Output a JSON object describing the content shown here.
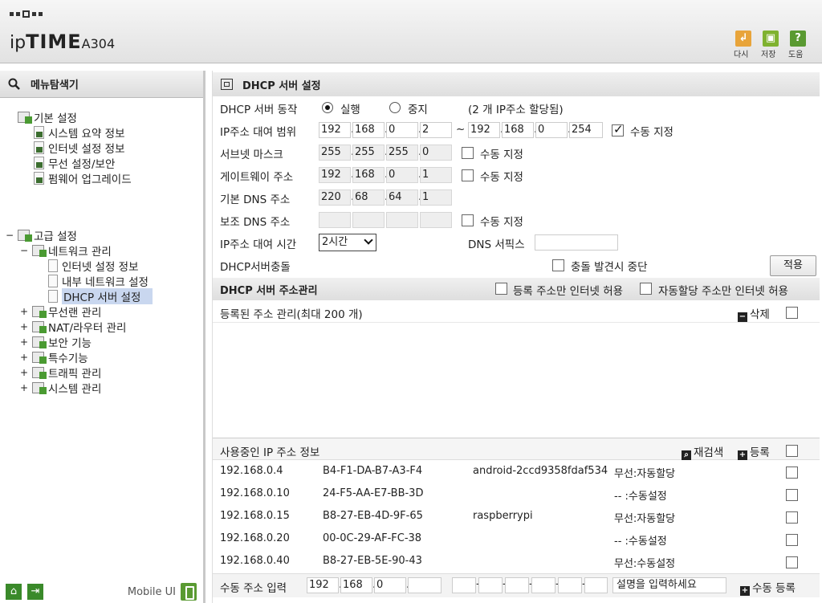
{
  "header": {
    "model_prefix": "ip",
    "model_brand": "TIME",
    "model_name": "A304",
    "buttons": [
      {
        "label": "다시",
        "icon": "undo-icon",
        "color": "#e8a43a"
      },
      {
        "label": "저장",
        "icon": "save-icon",
        "color": "#7fb230"
      },
      {
        "label": "도움",
        "icon": "help-icon",
        "color": "#5a9a32"
      }
    ]
  },
  "sidebar": {
    "title": "메뉴탐색기",
    "groups": [
      {
        "label": "기본 설정",
        "toggle": ""
      },
      {
        "label": "시스템 요약 정보"
      },
      {
        "label": "인터넷 설정 정보"
      },
      {
        "label": "무선 설정/보안"
      },
      {
        "label": "펌웨어 업그레이드"
      },
      {
        "label": "고급 설정",
        "toggle": "−"
      },
      {
        "label": "네트워크 관리",
        "toggle": "−"
      },
      {
        "label": "인터넷 설정 정보"
      },
      {
        "label": "내부 네트워크 설정"
      },
      {
        "label": "DHCP 서버 설정"
      },
      {
        "label": "무선랜 관리",
        "toggle": "+"
      },
      {
        "label": "NAT/라우터 관리",
        "toggle": "+"
      },
      {
        "label": "보안 기능",
        "toggle": "+"
      },
      {
        "label": "특수기능",
        "toggle": "+"
      },
      {
        "label": "트래픽 관리",
        "toggle": "+"
      },
      {
        "label": "시스템 관리",
        "toggle": "+"
      }
    ],
    "mobile_label": "Mobile UI"
  },
  "dhcp": {
    "title": "DHCP 서버 설정",
    "server_label": "DHCP 서버 동작",
    "run_label": "실행",
    "stop_label": "중지",
    "ip_note": "(2 개 IP주소 할당됨)",
    "range_label": "IP주소 대여 범위",
    "range_start": [
      "192",
      "168",
      "0",
      "2"
    ],
    "range_sep": "~",
    "range_end": [
      "192",
      "168",
      "0",
      "254"
    ],
    "manual_label": "수동 지정",
    "subnet_label": "서브넷 마스크",
    "subnet": [
      "255",
      "255",
      "255",
      "0"
    ],
    "gateway_label": "게이트웨이 주소",
    "gateway": [
      "192",
      "168",
      "0",
      "1"
    ],
    "dns1_label": "기본 DNS 주소",
    "dns1": [
      "220",
      "68",
      "64",
      "1"
    ],
    "dns2_label": "보조 DNS 주소",
    "lease_label": "IP주소 대여 시간",
    "lease_value": "2시간",
    "dns_suffix_label": "DNS 서픽스",
    "conflict_label": "DHCP서버충돌",
    "conflict_stop_label": "충돌 발견시 중단",
    "apply_label": "적용"
  },
  "addr_mgmt": {
    "title": "DHCP 서버 주소관리",
    "registered_only_label": "등록 주소만 인터넷 허용",
    "auto_only_label": "자동할당 주소만 인터넷 허용",
    "registered_list_label": "등록된 주소 관리(최대 200 개)",
    "delete_label": "삭제"
  },
  "in_use": {
    "title": "사용중인 IP 주소 정보",
    "rescan_label": "재검색",
    "register_label": "등록",
    "rows": [
      {
        "ip": "192.168.0.4",
        "mac": "B4-F1-DA-B7-A3-F4",
        "host": "android-2ccd9358fdaf534",
        "type": "무선:자동할당"
      },
      {
        "ip": "192.168.0.10",
        "mac": "24-F5-AA-E7-BB-3D",
        "host": "",
        "type": "-- :수동설정"
      },
      {
        "ip": "192.168.0.15",
        "mac": "B8-27-EB-4D-9F-65",
        "host": "raspberrypi",
        "type": "무선:자동할당"
      },
      {
        "ip": "192.168.0.20",
        "mac": "00-0C-29-AF-FC-38",
        "host": "",
        "type": "-- :수동설정"
      },
      {
        "ip": "192.168.0.40",
        "mac": "B8-27-EB-5E-90-43",
        "host": "",
        "type": "무선:수동설정"
      }
    ]
  },
  "manual_input": {
    "label": "수동 주소 입력",
    "ip": [
      "192",
      "168",
      "0",
      ""
    ],
    "desc_placeholder": "설명을 입력하세요",
    "register_label": "수동 등록"
  }
}
